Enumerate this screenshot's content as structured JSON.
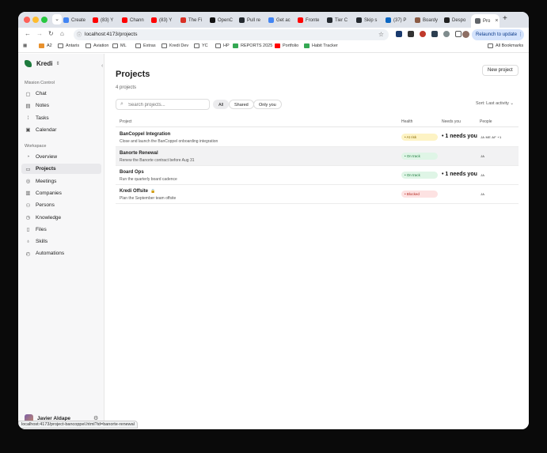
{
  "browser": {
    "tabs": [
      {
        "label": "Create",
        "color": "#4285f4"
      },
      {
        "label": "(83) Y",
        "color": "#ff0000"
      },
      {
        "label": "Chann",
        "color": "#ff0000"
      },
      {
        "label": "(83) Y",
        "color": "#ff0000"
      },
      {
        "label": "The Fi",
        "color": "#d93025"
      },
      {
        "label": "OpenC",
        "color": "#111111"
      },
      {
        "label": "Pull re",
        "color": "#24292f"
      },
      {
        "label": "Get ac",
        "color": "#4285f4"
      },
      {
        "label": "Fronte",
        "color": "#ff0000"
      },
      {
        "label": "Tier C",
        "color": "#24292f"
      },
      {
        "label": "Skip s",
        "color": "#24292f"
      },
      {
        "label": "(37) P",
        "color": "#0a66c2"
      },
      {
        "label": "Boardy",
        "color": "#8a5a44"
      },
      {
        "label": "Despo",
        "color": "#1f1f1f"
      },
      {
        "label": "Pro",
        "color": "#5f6368"
      }
    ],
    "url": "localhost:4173/projects",
    "relaunch_label": "Relaunch to update",
    "bookmarks": [
      "A2",
      "Antaris",
      "Aviation",
      "ML",
      "Extras",
      "Kredi Dev",
      "YC",
      "HP",
      "REPORTS 2025",
      "Portfolio",
      "Habit Tracker"
    ],
    "all_bookmarks": "All Bookmarks",
    "status_url": "localhost:4173/project-bancoppel.html?id=banorte-renewal"
  },
  "sidebar": {
    "brand": "Kredi",
    "section1": "Mission Control",
    "mission": [
      {
        "label": "Chat",
        "icon": "chat-icon"
      },
      {
        "label": "Notes",
        "icon": "notes-icon"
      },
      {
        "label": "Tasks",
        "icon": "tasks-icon"
      },
      {
        "label": "Calendar",
        "icon": "calendar-icon"
      }
    ],
    "section2": "Workspace",
    "workspace": [
      {
        "label": "Overview",
        "icon": "overview-icon"
      },
      {
        "label": "Projects",
        "icon": "folder-icon"
      },
      {
        "label": "Meetings",
        "icon": "meetings-icon"
      },
      {
        "label": "Companies",
        "icon": "building-icon"
      },
      {
        "label": "Persons",
        "icon": "persons-icon"
      },
      {
        "label": "Knowledge",
        "icon": "knowledge-icon"
      },
      {
        "label": "Files",
        "icon": "file-icon"
      },
      {
        "label": "Skills",
        "icon": "bulb-icon"
      },
      {
        "label": "Automations",
        "icon": "clock-icon"
      }
    ],
    "user": "Javier Aldape"
  },
  "main": {
    "title": "Projects",
    "count": "4 projects",
    "new_project": "New project",
    "search_placeholder": "Search projects...",
    "filters": [
      "All",
      "Shared",
      "Only you"
    ],
    "sort": "Sort: Last activity",
    "columns": [
      "Project",
      "Health",
      "Needs you",
      "People"
    ],
    "rows": [
      {
        "name": "BanCoppel Integration",
        "desc": "Close and launch the BanCoppel onboarding integration",
        "health": "At risk",
        "health_bg": "#fdf3c4",
        "health_fg": "#8a6a00",
        "needs": "1 needs you",
        "people": "JA ME AF +1",
        "locked": ""
      },
      {
        "name": "Banorte Renewal",
        "desc": "Renew the Banorte contract before Aug 31",
        "health": "On track",
        "health_bg": "#dff5e6",
        "health_fg": "#1d7a3d",
        "needs": "",
        "people": "JA",
        "locked": ""
      },
      {
        "name": "Board Ops",
        "desc": "Run the quarterly board cadence",
        "health": "On track",
        "health_bg": "#dff5e6",
        "health_fg": "#1d7a3d",
        "needs": "1 needs you",
        "people": "JA",
        "locked": ""
      },
      {
        "name": "Kredi Offsite",
        "desc": "Plan the September team offsite",
        "health": "Blocked",
        "health_bg": "#fde2e2",
        "health_fg": "#b3261e",
        "needs": "",
        "people": "JA",
        "locked": "🔒"
      }
    ]
  }
}
